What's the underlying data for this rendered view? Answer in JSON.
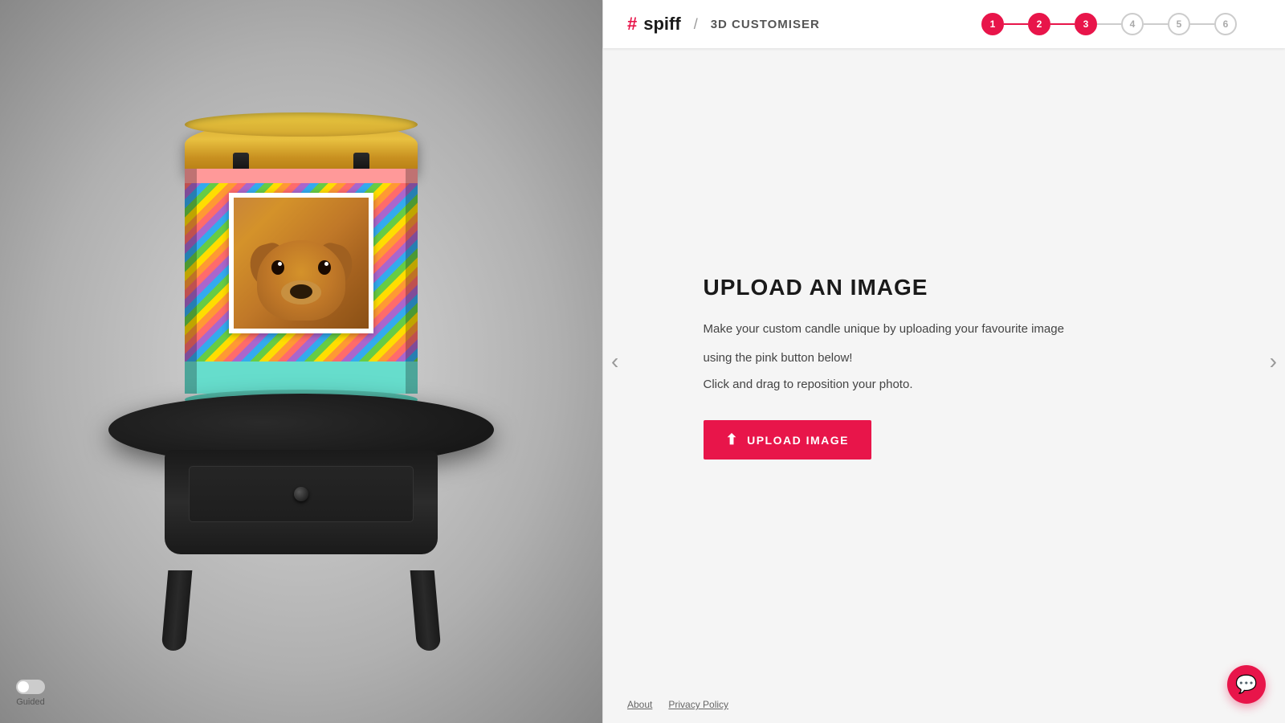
{
  "header": {
    "logo_hash": "#",
    "logo_brand": "spiff",
    "logo_divider": "/",
    "logo_subtitle": "3D CUSTOMISER"
  },
  "progress": {
    "steps": [
      {
        "number": "1",
        "state": "completed"
      },
      {
        "number": "2",
        "state": "completed"
      },
      {
        "number": "3",
        "state": "active"
      },
      {
        "number": "4",
        "state": "inactive"
      },
      {
        "number": "5",
        "state": "inactive"
      },
      {
        "number": "6",
        "state": "inactive"
      }
    ],
    "lines": [
      {
        "state": "done"
      },
      {
        "state": "done"
      },
      {
        "state": "inactive"
      },
      {
        "state": "inactive"
      },
      {
        "state": "inactive"
      }
    ]
  },
  "main": {
    "title": "UPLOAD AN IMAGE",
    "description_line1": "Make your custom candle unique by uploading your favourite image",
    "description_line2": "using the pink button below!",
    "hint": "Click and drag to reposition your photo.",
    "upload_button_label": "UPLOAD IMAGE"
  },
  "nav": {
    "prev_arrow": "‹",
    "next_arrow": "›"
  },
  "footer": {
    "about_label": "About",
    "privacy_label": "Privacy Policy"
  },
  "guided": {
    "label": "Guided"
  },
  "chat": {
    "icon": "💬"
  }
}
